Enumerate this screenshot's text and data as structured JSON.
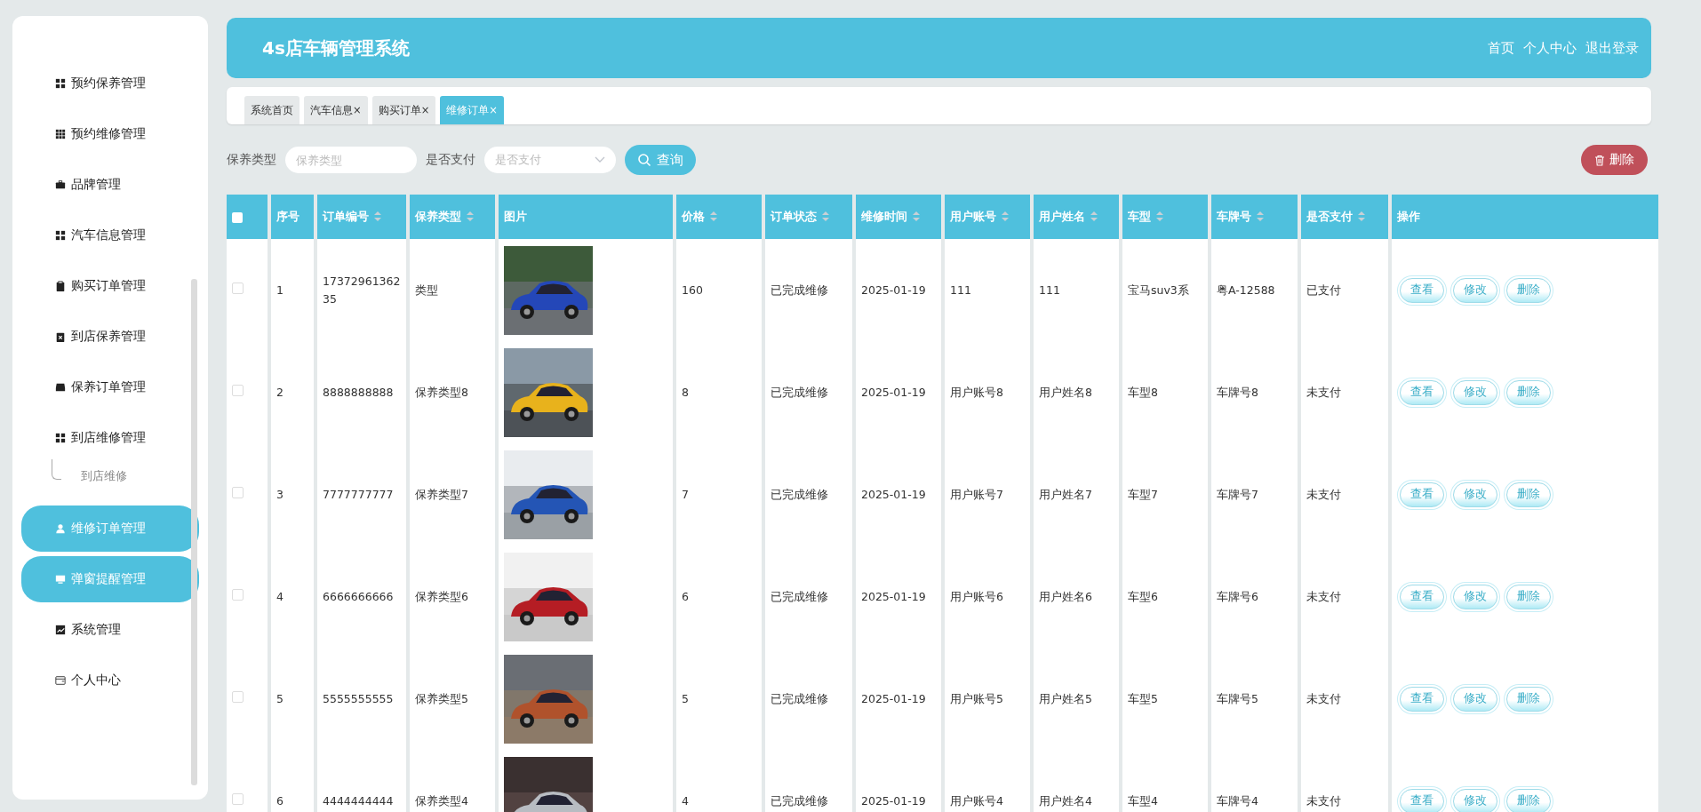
{
  "sidebar": {
    "items": [
      {
        "label": "预约保养管理",
        "kind": "grid",
        "highlighted": false
      },
      {
        "label": "预约维修管理",
        "kind": "grid9",
        "highlighted": false
      },
      {
        "label": "品牌管理",
        "kind": "case",
        "highlighted": false
      },
      {
        "label": "汽车信息管理",
        "kind": "grid",
        "highlighted": false
      },
      {
        "label": "购买订单管理",
        "kind": "clipboard",
        "highlighted": false
      },
      {
        "label": "到店保养管理",
        "kind": "clipx",
        "highlighted": false
      },
      {
        "label": "保养订单管理",
        "kind": "tray",
        "highlighted": false
      },
      {
        "label": "到店维修管理",
        "kind": "grid",
        "highlighted": false,
        "children": [
          {
            "label": "到店维修",
            "highlighted": false
          }
        ]
      },
      {
        "label": "维修订单管理",
        "kind": "user",
        "highlighted": true
      },
      {
        "label": "弹窗提醒管理",
        "kind": "monitor",
        "highlighted": true
      },
      {
        "label": "系统管理",
        "kind": "chart",
        "highlighted": false
      },
      {
        "label": "个人中心",
        "kind": "card",
        "highlighted": false
      }
    ]
  },
  "header": {
    "title": "4s店车辆管理系统",
    "links": [
      "首页",
      "个人中心",
      "退出登录"
    ]
  },
  "tabs": [
    {
      "label": "系统首页",
      "closable": false,
      "selected": false
    },
    {
      "label": "汽车信息",
      "closable": true,
      "selected": false
    },
    {
      "label": "购买订单",
      "closable": true,
      "selected": false
    },
    {
      "label": "维修订单",
      "closable": true,
      "selected": true
    }
  ],
  "close_glyph": "×",
  "filters": {
    "fields": [
      {
        "kind": "input",
        "label": "保养类型",
        "placeholder": "保养类型"
      },
      {
        "kind": "select",
        "label": "是否支付",
        "placeholder": "是否支付"
      }
    ],
    "search_button": "查询",
    "delete_button": "删除"
  },
  "table": {
    "columns": [
      {
        "kind": "checkbox",
        "checked": false,
        "sortable": false
      },
      {
        "kind": "text",
        "label": "序号",
        "sortable": false
      },
      {
        "kind": "text",
        "label": "订单编号",
        "sortable": true
      },
      {
        "kind": "text",
        "label": "保养类型",
        "sortable": true
      },
      {
        "label": "图片",
        "sortable": false
      },
      {
        "kind": "text",
        "label": "价格",
        "sortable": true
      },
      {
        "kind": "text",
        "label": "订单状态",
        "sortable": true
      },
      {
        "kind": "text",
        "label": "维修时间",
        "sortable": true
      },
      {
        "kind": "text",
        "label": "用户账号",
        "sortable": true
      },
      {
        "kind": "text",
        "label": "用户姓名",
        "sortable": true
      },
      {
        "kind": "text",
        "label": "车型",
        "sortable": true
      },
      {
        "kind": "text",
        "label": "车牌号",
        "sortable": true
      },
      {
        "kind": "text",
        "label": "是否支付",
        "sortable": true
      },
      {
        "kind": "text",
        "label": "操作",
        "sortable": false
      }
    ],
    "rows": [
      {
        "cells": [
          {
            "kind": "checkbox",
            "checked": false
          },
          "1",
          "1737296136235",
          "类型",
          {
            "kind": "picture"
          },
          "160",
          "已完成维修",
          "2025-01-19",
          "111",
          "111",
          "宝马suv3系",
          "粤A-12588",
          "已支付",
          {
            "kind": "actions",
            "buttons": [
              "查看",
              "修改",
              "删除"
            ]
          }
        ]
      },
      {
        "cells": [
          {
            "kind": "checkbox",
            "checked": false
          },
          "2",
          "8888888888",
          "保养类型8",
          {
            "kind": "picture"
          },
          "8",
          "已完成维修",
          "2025-01-19",
          "用户账号8",
          "用户姓名8",
          "车型8",
          "车牌号8",
          "未支付",
          {
            "kind": "actions",
            "buttons": [
              "查看",
              "修改",
              "删除"
            ]
          }
        ]
      },
      {
        "cells": [
          {
            "kind": "checkbox",
            "checked": false
          },
          "3",
          "7777777777",
          "保养类型7",
          {
            "kind": "picture"
          },
          "7",
          "已完成维修",
          "2025-01-19",
          "用户账号7",
          "用户姓名7",
          "车型7",
          "车牌号7",
          "未支付",
          {
            "kind": "actions",
            "buttons": [
              "查看",
              "修改",
              "删除"
            ]
          }
        ]
      },
      {
        "cells": [
          {
            "kind": "checkbox",
            "checked": false
          },
          "4",
          "6666666666",
          "保养类型6",
          {
            "kind": "picture"
          },
          "6",
          "已完成维修",
          "2025-01-19",
          "用户账号6",
          "用户姓名6",
          "车型6",
          "车牌号6",
          "未支付",
          {
            "kind": "actions",
            "buttons": [
              "查看",
              "修改",
              "删除"
            ]
          }
        ]
      },
      {
        "cells": [
          {
            "kind": "checkbox",
            "checked": false
          },
          "5",
          "5555555555",
          "保养类型5",
          {
            "kind": "picture"
          },
          "5",
          "已完成维修",
          "2025-01-19",
          "用户账号5",
          "用户姓名5",
          "车型5",
          "车牌号5",
          "未支付",
          {
            "kind": "actions",
            "buttons": [
              "查看",
              "修改",
              "删除"
            ]
          }
        ]
      },
      {
        "cells": [
          {
            "kind": "checkbox",
            "checked": false
          },
          "6",
          "4444444444",
          "保养类型4",
          {
            "kind": "picture"
          },
          "4",
          "已完成维修",
          "2025-01-19",
          "用户账号4",
          "用户姓名4",
          "车型4",
          "车牌号4",
          "未支付",
          {
            "kind": "actions",
            "buttons": [
              "查看",
              "修改",
              "删除"
            ]
          }
        ]
      }
    ]
  }
}
